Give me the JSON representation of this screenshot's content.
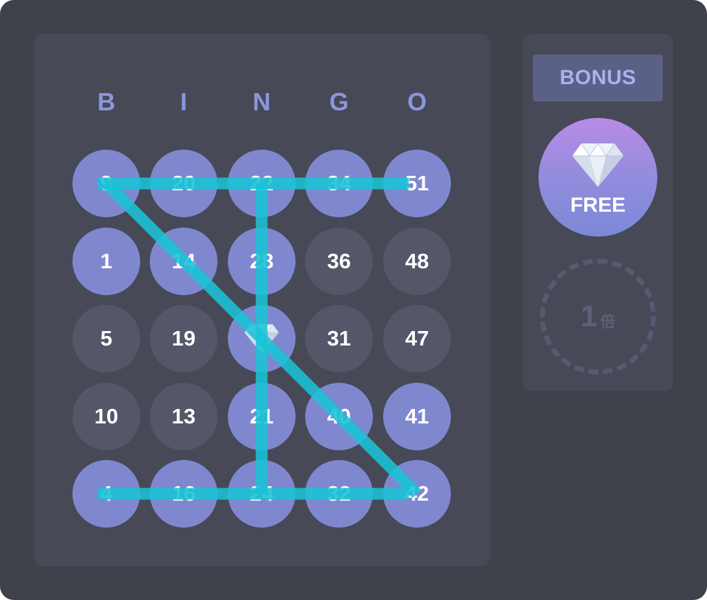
{
  "board": {
    "headers": [
      "B",
      "I",
      "N",
      "G",
      "O"
    ],
    "cells": [
      [
        "9",
        "20",
        "22",
        "34",
        "51"
      ],
      [
        "1",
        "14",
        "28",
        "36",
        "48"
      ],
      [
        "5",
        "19",
        "",
        "31",
        "47"
      ],
      [
        "10",
        "13",
        "21",
        "40",
        "41"
      ],
      [
        "4",
        "16",
        "24",
        "32",
        "42"
      ]
    ],
    "marked": [
      [
        true,
        true,
        true,
        true,
        true
      ],
      [
        true,
        true,
        true,
        false,
        false
      ],
      [
        false,
        false,
        true,
        false,
        false
      ],
      [
        false,
        false,
        true,
        true,
        true
      ],
      [
        true,
        true,
        true,
        true,
        true
      ]
    ],
    "center_icon": "diamond-icon",
    "winning_line_cells": [
      [
        0,
        0
      ],
      [
        0,
        1
      ],
      [
        0,
        2
      ],
      [
        0,
        3
      ],
      [
        0,
        4
      ],
      [
        0,
        0
      ],
      [
        1,
        1
      ],
      [
        2,
        2
      ],
      [
        3,
        3
      ],
      [
        4,
        4
      ],
      [
        0,
        2
      ],
      [
        1,
        2
      ],
      [
        2,
        2
      ],
      [
        3,
        2
      ],
      [
        4,
        2
      ],
      [
        4,
        0
      ],
      [
        4,
        1
      ],
      [
        4,
        2
      ],
      [
        4,
        3
      ],
      [
        4,
        4
      ]
    ]
  },
  "side": {
    "bonus_label": "BONUS",
    "free_icon": "diamond-icon",
    "free_label": "FREE",
    "multiplier_value": "1",
    "multiplier_unit": "倍"
  },
  "colors": {
    "background": "#40424b",
    "panel": "#474957",
    "marked_cell": "#7f88cf",
    "unmarked_cell": "#545768",
    "line": "#19c3d6",
    "header_letter": "#8c95dc",
    "bonus_button": "#5b6087",
    "bonus_text": "#aab3ee"
  }
}
